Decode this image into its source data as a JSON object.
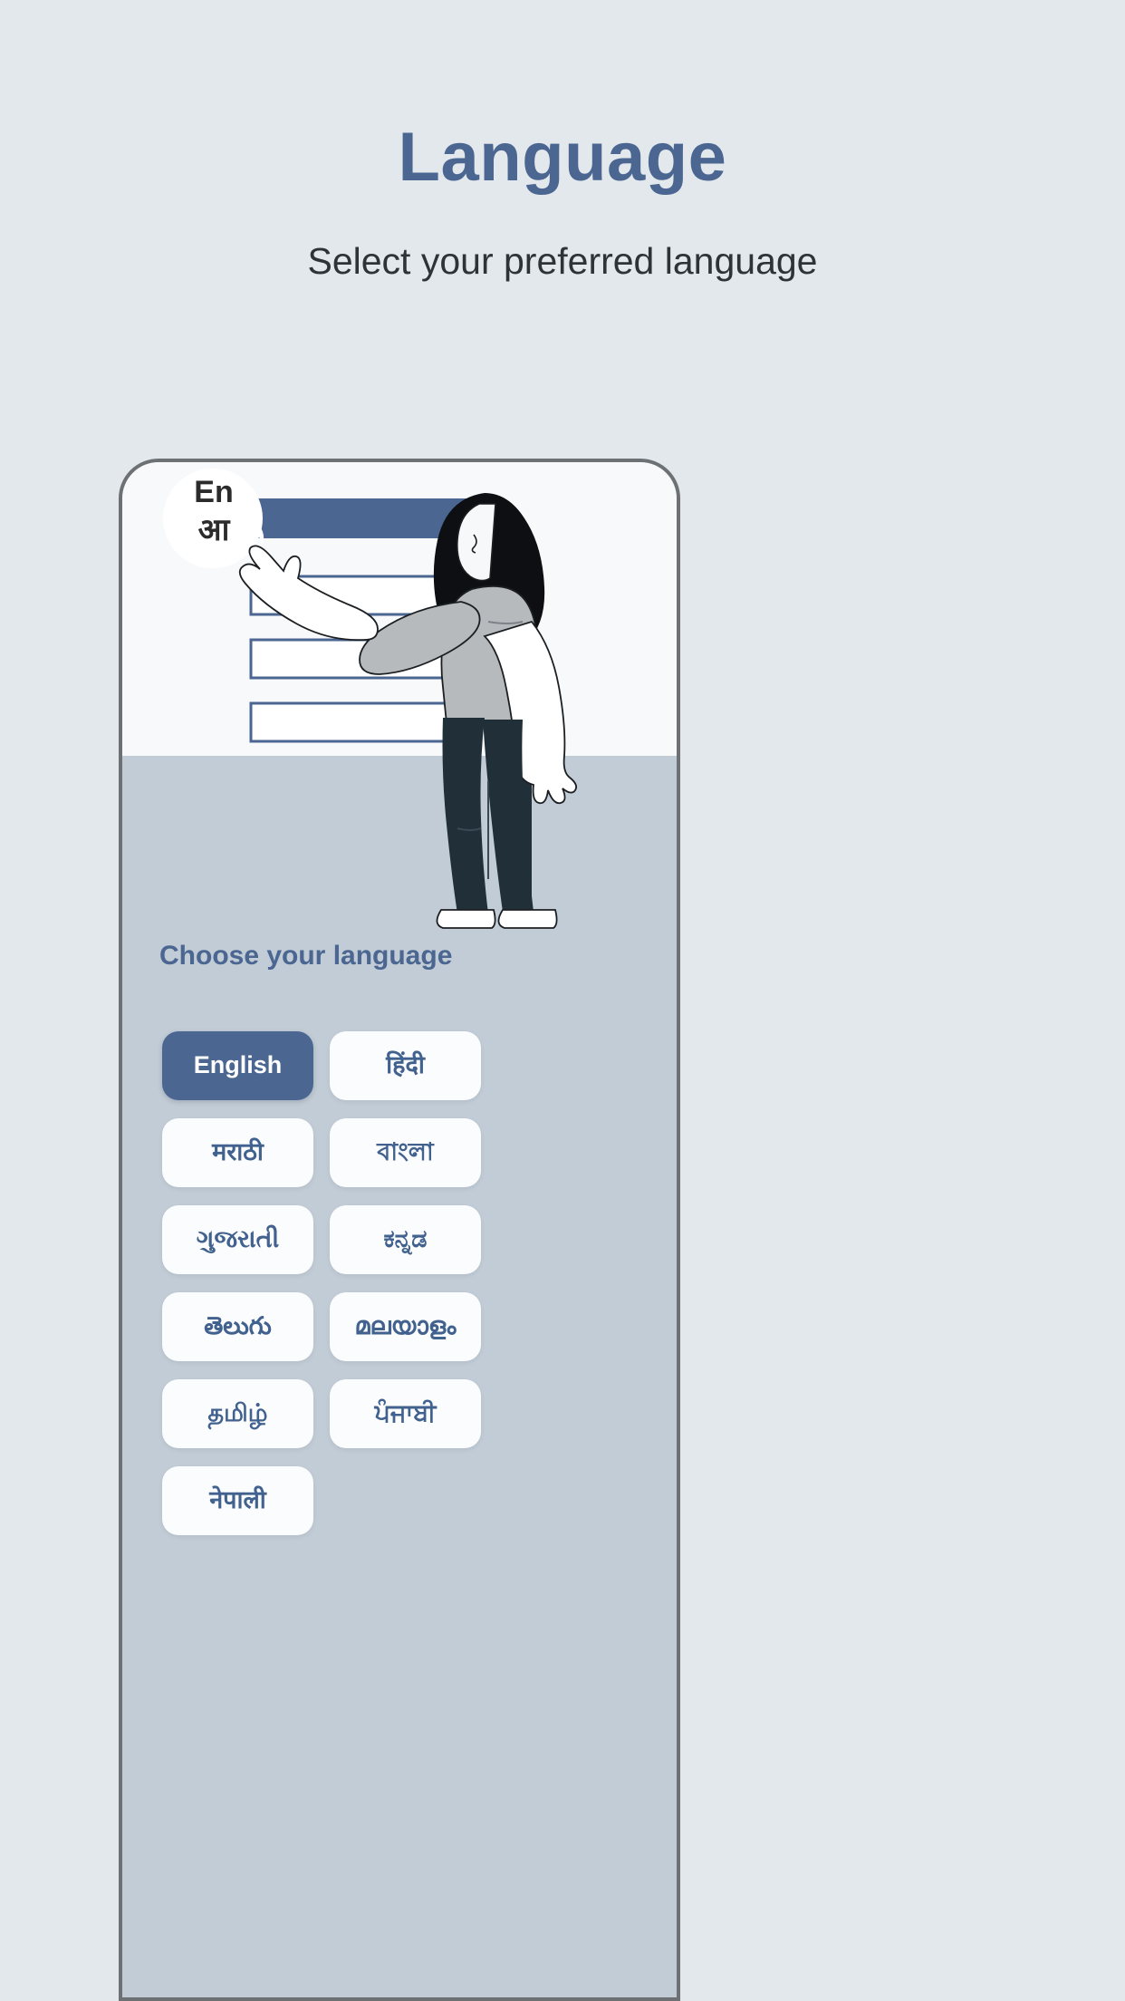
{
  "header": {
    "title": "Language",
    "subtitle": "Select your preferred language"
  },
  "illustration": {
    "bubble_line1": "En",
    "bubble_line2": "आ",
    "name": "woman-pointing-at-language-form"
  },
  "phone": {
    "choose_label": "Choose your language",
    "languages": [
      {
        "label": "English",
        "selected": true
      },
      {
        "label": "हिंदी",
        "selected": false
      },
      {
        "label": "मराठी",
        "selected": false
      },
      {
        "label": "বাংলা",
        "selected": false
      },
      {
        "label": "ગુજરાતી",
        "selected": false
      },
      {
        "label": "ಕನ್ನಡ",
        "selected": false
      },
      {
        "label": "తెలుగు",
        "selected": false
      },
      {
        "label": "മലയാളം",
        "selected": false
      },
      {
        "label": "தமிழ்",
        "selected": false
      },
      {
        "label": "ਪੰਜਾਬੀ",
        "selected": false
      },
      {
        "label": "नेपाली",
        "selected": false
      }
    ]
  },
  "colors": {
    "page_background": "#e3e8ec",
    "accent_blue": "#4a6691",
    "title_blue": "#4a6691",
    "subtitle_text": "#2e3338",
    "phone_lower_background": "#c2ccd6",
    "phone_upper_background": "#f8f9fb",
    "phone_border": "#6d7174",
    "button_background": "#fbfcfd",
    "button_text": "#41618e",
    "selected_button_text": "#ffffff"
  }
}
